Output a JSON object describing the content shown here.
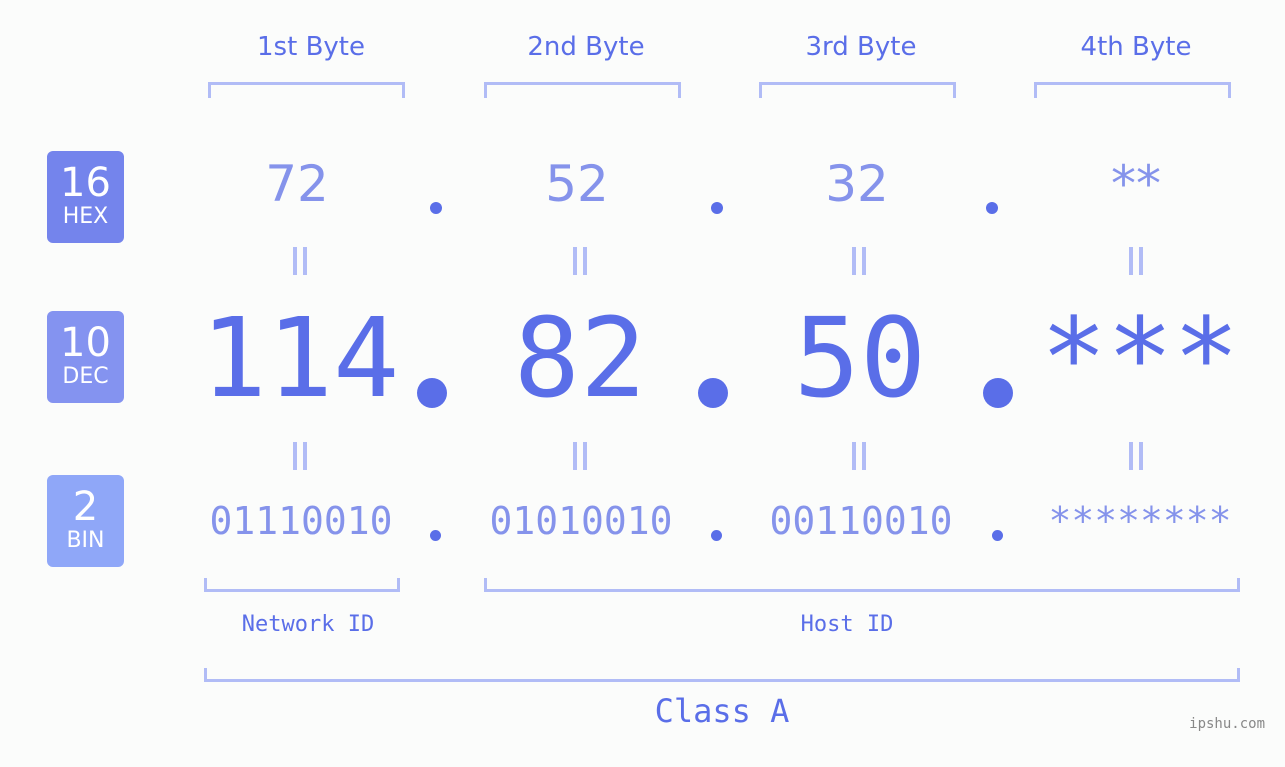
{
  "headers": [
    "1st Byte",
    "2nd Byte",
    "3rd Byte",
    "4th Byte"
  ],
  "rows": {
    "hex": {
      "base": "16",
      "label": "HEX",
      "values": [
        "72",
        "52",
        "32",
        "**"
      ],
      "color": "#7484ec"
    },
    "dec": {
      "base": "10",
      "label": "DEC",
      "values": [
        "114",
        "82",
        "50",
        "***"
      ],
      "color": "#8493f0"
    },
    "bin": {
      "base": "2",
      "label": "BIN",
      "values": [
        "01110010",
        "01010010",
        "00110010",
        "********"
      ],
      "color": "#8fa7f8"
    }
  },
  "segments": {
    "network": "Network ID",
    "host": "Host ID",
    "class": "Class A"
  },
  "watermark": "ipshu.com",
  "colors": {
    "primary": "#5a6ee8",
    "secondary": "#8593eb",
    "bracket": "#b1bcf6"
  }
}
